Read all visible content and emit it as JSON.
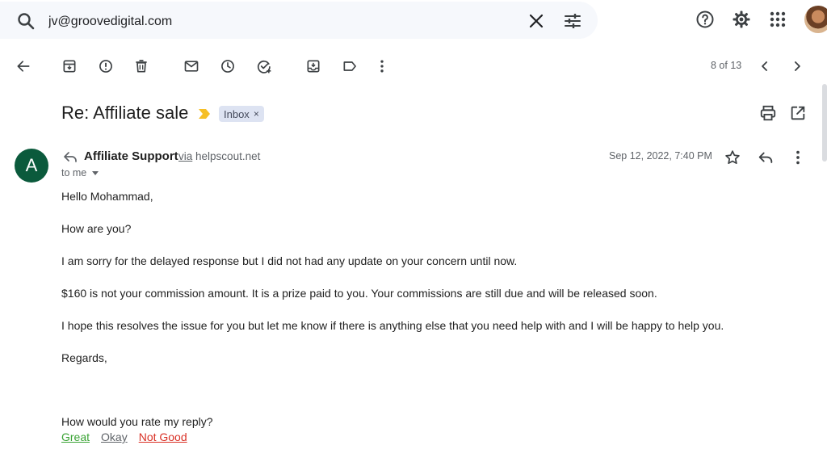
{
  "search": {
    "value": "jv@groovedigital.com"
  },
  "toolbar": {
    "counter": "8 of 13"
  },
  "email": {
    "subject": "Re: Affiliate sale",
    "label": "Inbox",
    "label_remove": "×",
    "sender_initial": "A",
    "sender_name": "Affiliate Support",
    "via_word": "via",
    "via_domain": "helpscout.net",
    "to": "to me",
    "date": "Sep 12, 2022, 7:40 PM",
    "body": [
      "Hello Mohammad,",
      "How are you?",
      "I am sorry for the delayed response but I did not had any update on your concern until now.",
      "$160 is not your commission amount. It is a prize paid to you. Your commissions are still due and will be released soon.",
      "I hope this resolves the issue for you but let me know if there is anything else that you need help with and I will be happy to help you.",
      "Regards,"
    ],
    "rating_question": "How would you rate my reply?",
    "rating_options": [
      "Great",
      "Okay",
      "Not Good"
    ]
  },
  "colors": {
    "great": "#3aa335",
    "okay": "#5f6368",
    "not_good": "#d93025",
    "avatar": "#0b5a3c",
    "chip": "#dde3f2",
    "importance": "#f6bf26"
  },
  "icons": [
    "search-icon",
    "close-icon",
    "tune-icon",
    "help-icon",
    "gear-icon",
    "apps-icon",
    "back-arrow-icon",
    "archive-icon",
    "report-spam-icon",
    "trash-icon",
    "mark-unread-icon",
    "snooze-icon",
    "add-task-icon",
    "move-to-icon",
    "label-icon",
    "more-vert-icon",
    "chevron-left-icon",
    "chevron-right-icon",
    "print-icon",
    "open-new-window-icon",
    "star-icon",
    "reply-icon"
  ]
}
